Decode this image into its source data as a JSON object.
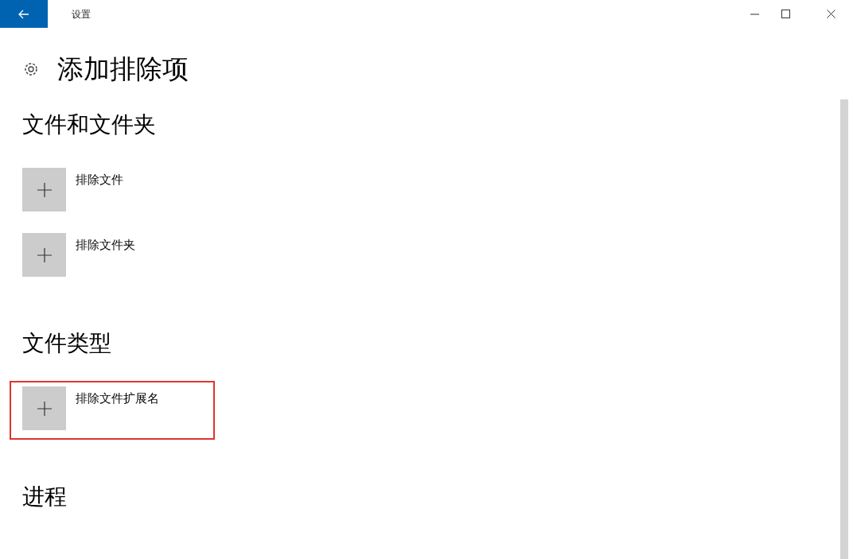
{
  "window": {
    "title": "设置"
  },
  "page": {
    "title": "添加排除项"
  },
  "sections": [
    {
      "heading": "文件和文件夹",
      "items": [
        {
          "label": "排除文件",
          "highlighted": false
        },
        {
          "label": "排除文件夹",
          "highlighted": false
        }
      ]
    },
    {
      "heading": "文件类型",
      "items": [
        {
          "label": "排除文件扩展名",
          "highlighted": true
        }
      ]
    },
    {
      "heading": "进程"
    }
  ]
}
